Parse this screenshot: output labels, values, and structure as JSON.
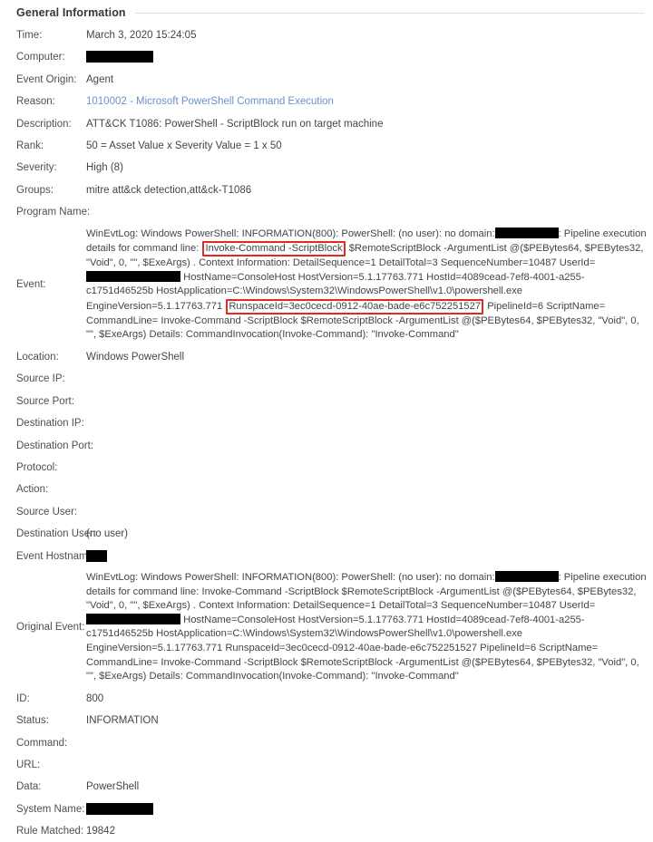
{
  "section": {
    "title": "General Information"
  },
  "colors": {
    "link": "#6f8fc9",
    "highlight_box": "#e02a22",
    "label_text": "#4a5056",
    "rule": "#d9dde1"
  },
  "fields": {
    "time": {
      "label": "Time:",
      "value": "March 3, 2020 15:24:05"
    },
    "computer": {
      "label": "Computer:",
      "value": ""
    },
    "event_origin": {
      "label": "Event Origin:",
      "value": "Agent"
    },
    "reason": {
      "label": "Reason:",
      "value": "1010002 - Microsoft PowerShell Command Execution"
    },
    "description": {
      "label": "Description:",
      "value": "ATT&CK T1086: PowerShell - ScriptBlock run on target machine"
    },
    "rank": {
      "label": "Rank:",
      "value": "50 = Asset Value x Severity Value = 1 x 50"
    },
    "severity": {
      "label": "Severity:",
      "value": "High (8)"
    },
    "groups": {
      "label": "Groups:",
      "value": "mitre att&ck detection,att&ck-T1086"
    },
    "program_name": {
      "label": "Program Name:",
      "value": ""
    },
    "event": {
      "label": "Event:",
      "segment_1": "WinEvtLog: Windows PowerShell: INFORMATION(800): PowerShell: (no user): no domain:",
      "segment_2": ": Pipeline execution details for command line:",
      "highlight_1": "Invoke-Command -ScriptBlock",
      "segment_3": "$RemoteScriptBlock -ArgumentList @($PEBytes64, $PEBytes32, \"Void\", 0, \"\", $ExeArgs) . Context Information: DetailSequence=1 DetailTotal=3 SequenceNumber=10487 UserId=",
      "segment_4": "HostName=ConsoleHost HostVersion=5.1.17763.771 HostId=4089cead-7ef8-4001-a255-c1751d46525b HostApplication=C:\\Windows\\System32\\WindowsPowerShell\\v1.0\\powershell.exe EngineVersion=5.1.17763.771",
      "highlight_2": "RunspaceId=3ec0cecd-0912-40ae-bade-e6c752251527",
      "segment_5": "PipelineId=6 ScriptName= CommandLine= Invoke-Command -ScriptBlock $RemoteScriptBlock -ArgumentList @($PEBytes64, $PEBytes32, \"Void\", 0, \"\", $ExeArgs) Details: CommandInvocation(Invoke-Command): \"Invoke-Command\""
    },
    "location": {
      "label": "Location:",
      "value": "Windows PowerShell"
    },
    "source_ip": {
      "label": "Source IP:",
      "value": ""
    },
    "source_port": {
      "label": "Source Port:",
      "value": ""
    },
    "destination_ip": {
      "label": "Destination IP:",
      "value": ""
    },
    "destination_port": {
      "label": "Destination Port:",
      "value": ""
    },
    "protocol": {
      "label": "Protocol:",
      "value": ""
    },
    "action": {
      "label": "Action:",
      "value": ""
    },
    "source_user": {
      "label": "Source User:",
      "value": ""
    },
    "destination_user": {
      "label": "Destination User:",
      "value": "(no user)"
    },
    "event_hostname": {
      "label": "Event Hostname:",
      "value": ""
    },
    "original_event": {
      "label": "Original Event:",
      "segment_1": "WinEvtLog: Windows PowerShell: INFORMATION(800): PowerShell: (no user): no domain:",
      "segment_2": ": Pipeline execution details for command line: Invoke-Command -ScriptBlock $RemoteScriptBlock -ArgumentList @($PEBytes64, $PEBytes32, \"Void\", 0, \"\", $ExeArgs) . Context Information: DetailSequence=1 DetailTotal=3 SequenceNumber=10487 UserId=",
      "segment_3": "HostName=ConsoleHost HostVersion=5.1.17763.771 HostId=4089cead-7ef8-4001-a255-c1751d46525b HostApplication=C:\\Windows\\System32\\WindowsPowerShell\\v1.0\\powershell.exe EngineVersion=5.1.17763.771 RunspaceId=3ec0cecd-0912-40ae-bade-e6c752251527 PipelineId=6 ScriptName= CommandLine= Invoke-Command -ScriptBlock $RemoteScriptBlock -ArgumentList @($PEBytes64, $PEBytes32, \"Void\", 0, \"\", $ExeArgs) Details: CommandInvocation(Invoke-Command): \"Invoke-Command\""
    },
    "id": {
      "label": "ID:",
      "value": "800"
    },
    "status": {
      "label": "Status:",
      "value": "INFORMATION"
    },
    "command": {
      "label": "Command:",
      "value": ""
    },
    "url": {
      "label": "URL:",
      "value": ""
    },
    "data": {
      "label": "Data:",
      "value": "PowerShell"
    },
    "system_name": {
      "label": "System Name:",
      "value": ""
    },
    "rule_matched": {
      "label": "Rule Matched:",
      "value": "19842"
    }
  }
}
